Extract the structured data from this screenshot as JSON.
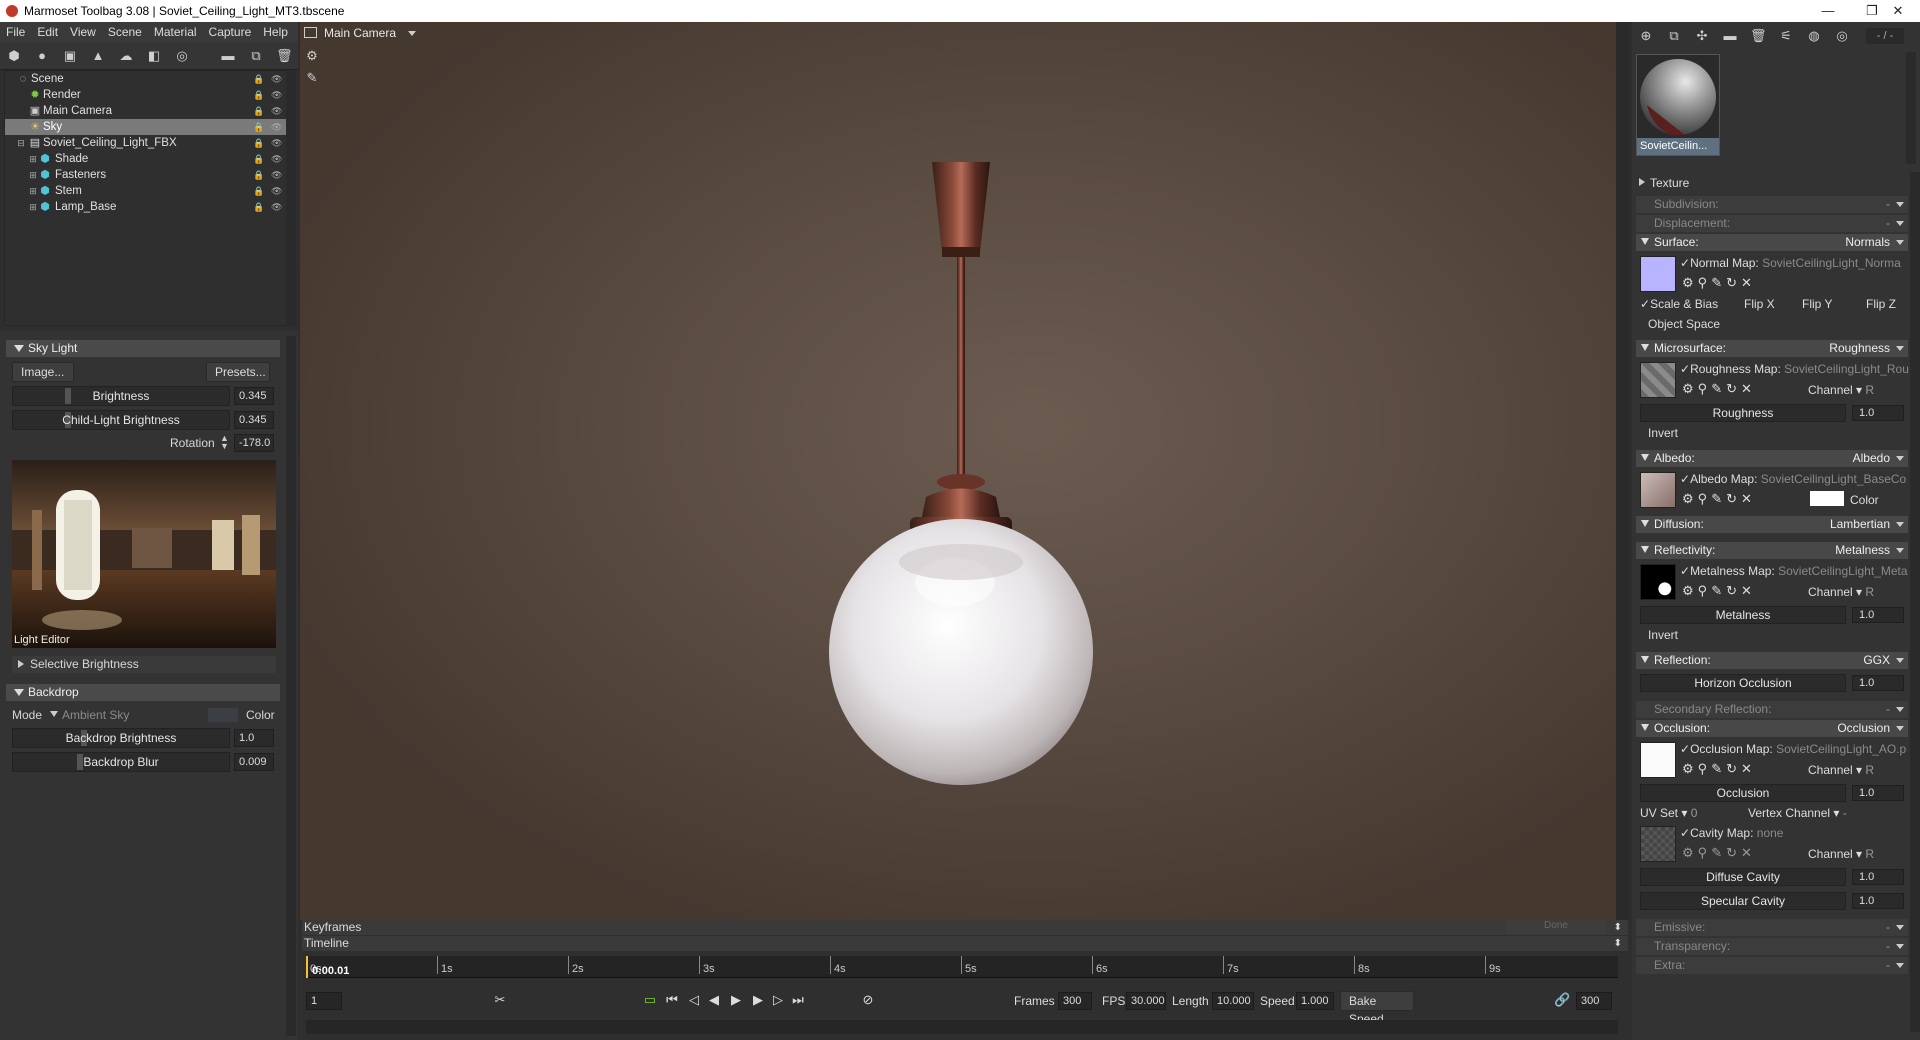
{
  "window": {
    "title": "Marmoset Toolbag 3.08  |  Soviet_Ceiling_Light_MT3.tbscene"
  },
  "menu": [
    "File",
    "Edit",
    "View",
    "Scene",
    "Material",
    "Capture",
    "Help"
  ],
  "viewport": {
    "camera_label": "Main Camera"
  },
  "outliner": {
    "items": [
      {
        "label": "Scene"
      },
      {
        "label": "Render"
      },
      {
        "label": "Main Camera"
      },
      {
        "label": "Sky"
      },
      {
        "label": "Soviet_Ceiling_Light_FBX"
      },
      {
        "label": "Shade"
      },
      {
        "label": "Fasteners"
      },
      {
        "label": "Stem"
      },
      {
        "label": "Lamp_Base"
      }
    ]
  },
  "sky_light": {
    "header": "Sky Light",
    "image_btn": "Image...",
    "presets_btn": "Presets...",
    "brightness_label": "Brightness",
    "brightness_value": "0.345",
    "child_label": "Child-Light Brightness",
    "child_value": "0.345",
    "rotation_label": "Rotation",
    "rotation_value": "-178.0",
    "light_editor": "Light Editor",
    "selective": "Selective Brightness"
  },
  "backdrop": {
    "header": "Backdrop",
    "mode_label": "Mode",
    "mode_value": "Ambient Sky",
    "color_label": "Color",
    "brightness_label": "Backdrop Brightness",
    "brightness_value": "1.0",
    "blur_label": "Backdrop Blur",
    "blur_value": "0.009"
  },
  "material": {
    "name": "SovietCeilin...",
    "counter": "- / -",
    "texture": "Texture",
    "subdivision": {
      "label": "Subdivision:",
      "value": "-"
    },
    "displacement": {
      "label": "Displacement:",
      "value": "-"
    },
    "surface": {
      "label": "Surface:",
      "value": "Normals",
      "map_label": "Normal Map:",
      "map_file": "SovietCeilingLight_Norma",
      "scale_bias": "Scale & Bias",
      "flip_x": "Flip X",
      "flip_y": "Flip Y",
      "flip_z": "Flip Z",
      "object_space": "Object Space"
    },
    "microsurface": {
      "label": "Microsurface:",
      "value": "Roughness",
      "map_label": "Roughness Map:",
      "map_file": "SovietCeilingLight_Rou",
      "channel": "Channel",
      "channel_val": "R",
      "slider": "Roughness",
      "slider_val": "1.0",
      "invert": "Invert"
    },
    "albedo": {
      "label": "Albedo:",
      "value": "Albedo",
      "map_label": "Albedo Map:",
      "map_file": "SovietCeilingLight_BaseCo",
      "color": "Color"
    },
    "diffusion": {
      "label": "Diffusion:",
      "value": "Lambertian"
    },
    "reflectivity": {
      "label": "Reflectivity:",
      "value": "Metalness",
      "map_label": "Metalness Map:",
      "map_file": "SovietCeilingLight_Meta",
      "channel": "Channel",
      "channel_val": "R",
      "slider": "Metalness",
      "slider_val": "1.0",
      "invert": "Invert"
    },
    "reflection": {
      "label": "Reflection:",
      "value": "GGX",
      "slider": "Horizon Occlusion",
      "slider_val": "1.0"
    },
    "secondary": {
      "label": "Secondary Reflection:",
      "value": "-"
    },
    "occlusion": {
      "label": "Occlusion:",
      "value": "Occlusion",
      "map_label": "Occlusion Map:",
      "map_file": "SovietCeilingLight_AO.p",
      "channel": "Channel",
      "channel_val": "R",
      "slider": "Occlusion",
      "slider_val": "1.0",
      "uvset": "UV Set",
      "uvset_val": "0",
      "vertex": "Vertex Channel",
      "vertex_val": "-",
      "cavity_label": "Cavity Map:",
      "cavity_file": "none",
      "cavity_channel": "Channel",
      "cavity_channel_val": "R",
      "diffuse_cavity": "Diffuse Cavity",
      "diffuse_cavity_val": "1.0",
      "specular_cavity": "Specular Cavity",
      "specular_cavity_val": "1.0"
    },
    "emissive": {
      "label": "Emissive:",
      "value": "-"
    },
    "transparency": {
      "label": "Transparency:",
      "value": "-"
    },
    "extra": {
      "label": "Extra:",
      "value": "-"
    }
  },
  "timeline": {
    "keyframes": "Keyframes",
    "timeline": "Timeline",
    "current": "0:00.01",
    "ticks": [
      "0s",
      "1s",
      "2s",
      "3s",
      "4s",
      "5s",
      "6s",
      "7s",
      "8s",
      "9s"
    ],
    "frame": "1",
    "frames_label": "Frames",
    "frames": "300",
    "fps_label": "FPS",
    "fps": "30.000",
    "length_label": "Length",
    "length": "10.000",
    "speed_label": "Speed",
    "speed": "1.000",
    "bake": "Bake Speed",
    "end": "300",
    "faded": "Done"
  },
  "colors": {
    "accent_green": "#7fd13b",
    "selection": "#7a7a7a",
    "normal_map": "#b9b4ff"
  }
}
